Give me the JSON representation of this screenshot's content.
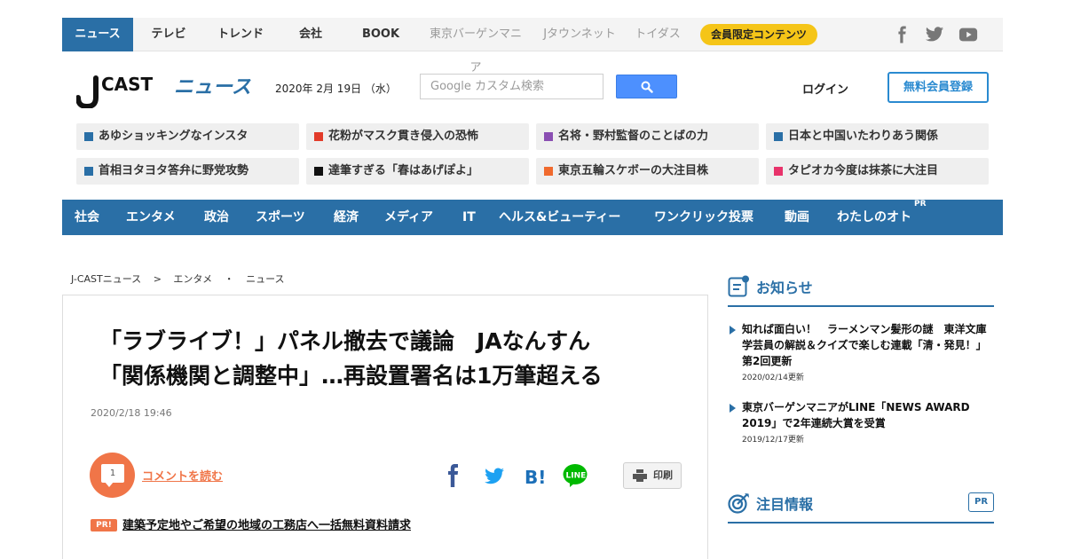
{
  "topnav": {
    "tabs": [
      {
        "label": "ニュース"
      },
      {
        "label": "テレビ"
      },
      {
        "label": "トレンド"
      },
      {
        "label": "会社"
      },
      {
        "label": "BOOK"
      },
      {
        "label": "東京バーゲンマニア"
      },
      {
        "label": "Jタウンネット"
      },
      {
        "label": "トイダス"
      }
    ],
    "member_badge": "会員限定コンテンツ",
    "social": [
      "facebook-icon",
      "twitter-icon",
      "youtube-icon"
    ]
  },
  "header": {
    "logo_text": "J-CASTニュース",
    "date": "2020年 2月 19日 （水）",
    "search_placeholder": "Google カスタム検索",
    "login_label": "ログイン",
    "register_label": "無料会員登録"
  },
  "trending": [
    {
      "label": "あゆショッキングなインスタ",
      "color": "#2a6fa6"
    },
    {
      "label": "花粉がマスク貫き侵入の恐怖",
      "color": "#e23b2a"
    },
    {
      "label": "名将・野村監督のことばの力",
      "color": "#8a4fb2"
    },
    {
      "label": "日本と中国いたわりあう関係",
      "color": "#2a6fa6"
    },
    {
      "label": "首相ヨタヨタ答弁に野党攻勢",
      "color": "#2a6fa6"
    },
    {
      "label": "達筆すぎる「春はあげぽよ」",
      "color": "#111111"
    },
    {
      "label": "東京五輪スケボーの大注目株",
      "color": "#f06a2e"
    },
    {
      "label": "タピオカ今度は抹茶に大注目",
      "color": "#e8336b"
    }
  ],
  "categories": [
    {
      "label": "社会"
    },
    {
      "label": "エンタメ"
    },
    {
      "label": "政治"
    },
    {
      "label": "スポーツ"
    },
    {
      "label": "経済"
    },
    {
      "label": "メディア"
    },
    {
      "label": "IT"
    },
    {
      "label": "ヘルス&ビューティー"
    },
    {
      "label": "ワンクリック投票"
    },
    {
      "label": "動画"
    },
    {
      "label": "わたしのオト"
    }
  ],
  "categories_pr": "PR",
  "breadcrumb": [
    "J-CASTニュース",
    ">",
    "エンタメ",
    "・",
    "ニュース"
  ],
  "article": {
    "title_line1": "「ラブライブ！」パネル撤去で議論　JAなんすん",
    "title_line2": "「関係機関と調整中」…再設置署名は1万筆超える",
    "published": "2020/2/18 19:46",
    "comment_count": "1",
    "comment_label": "コメントを読む",
    "print_label": "印刷",
    "pr_label": "PR!",
    "pr_text": "建築予定地やご希望の地域の工務店へ一括無料資料請求"
  },
  "sidebar": {
    "notice_title": "お知らせ",
    "news": [
      {
        "text": "知れば面白い！　ラーメンマン髪形の謎　東洋文庫学芸員の解説＆クイズで楽しむ連載「清・発見！」第2回更新",
        "date": "2020/02/14更新"
      },
      {
        "text": "東京バーゲンマニアがLINE「NEWS AWARD 2019」で2年連続大賞を受賞",
        "date": "2019/12/17更新"
      }
    ],
    "featured_title": "注目情報",
    "featured_pr": "PR"
  },
  "colors": {
    "brand_blue": "#2a6fa6",
    "accent_orange": "#f07548",
    "badge_yellow": "#f5c518"
  }
}
